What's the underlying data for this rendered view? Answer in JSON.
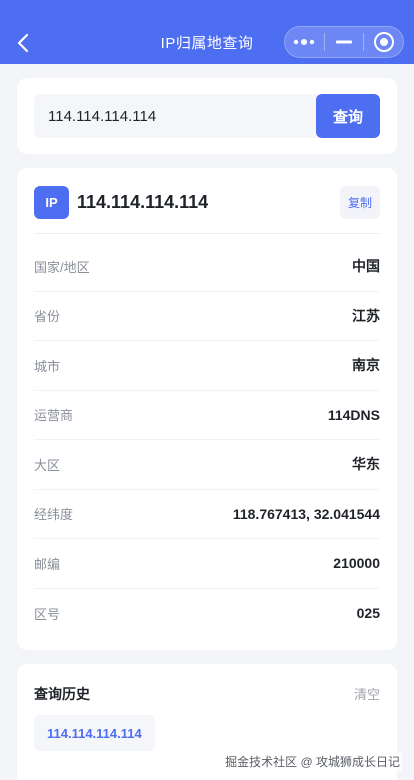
{
  "nav": {
    "title": "IP归属地查询"
  },
  "search": {
    "value": "114.114.114.114",
    "button": "查询"
  },
  "result": {
    "badge": "IP",
    "ip": "114.114.114.114",
    "copy": "复制",
    "rows": [
      {
        "label": "国家/地区",
        "value": "中国"
      },
      {
        "label": "省份",
        "value": "江苏"
      },
      {
        "label": "城市",
        "value": "南京"
      },
      {
        "label": "运营商",
        "value": "114DNS"
      },
      {
        "label": "大区",
        "value": "华东"
      },
      {
        "label": "经纬度",
        "value": "118.767413, 32.041544"
      },
      {
        "label": "邮编",
        "value": "210000"
      },
      {
        "label": "区号",
        "value": "025"
      }
    ]
  },
  "history": {
    "title": "查询历史",
    "clear": "清空",
    "items": [
      "114.114.114.114"
    ]
  },
  "watermark": "掘金技术社区 @ 攻城狮成长日记",
  "colors": {
    "primary": "#4e6ef2",
    "background": "#f4f5f9"
  }
}
